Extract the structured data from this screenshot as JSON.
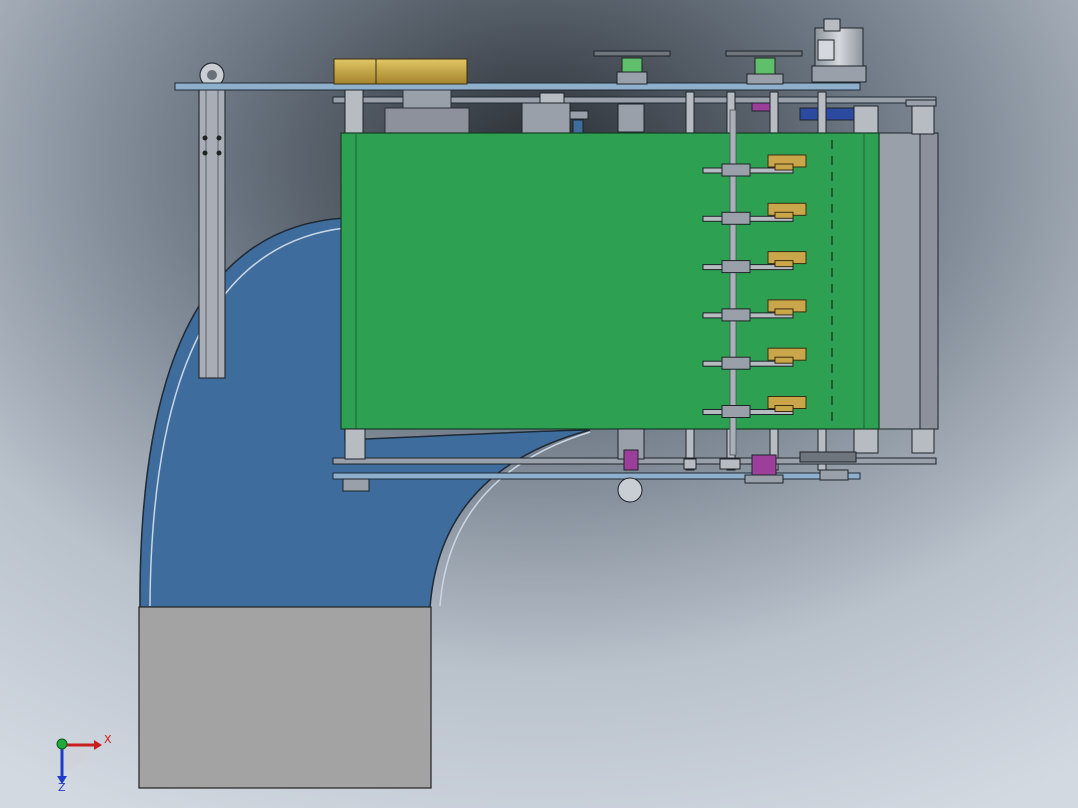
{
  "viewport": {
    "background_colors": [
      "#2a2e34",
      "#6f7a86",
      "#b9c1cb",
      "#d2d9e1"
    ],
    "description_colors": {
      "belt_green": "#2ea052",
      "curve_blue": "#3e6c9c",
      "hopper_gray": "#a3a3a3",
      "frame_gray": "#9aa0aa",
      "brass": "#c9a64a",
      "motor_gray": "#b7bcc3",
      "accent_purple": "#9b3f9b",
      "accent_green": "#5fbf6a"
    }
  },
  "triad": {
    "x_label": "X",
    "z_label": "Z",
    "x_color": "#c81e1e",
    "z_color": "#1e3cc8",
    "y_color": "#1faa3a"
  },
  "parts": {
    "scraper_count": 6
  }
}
